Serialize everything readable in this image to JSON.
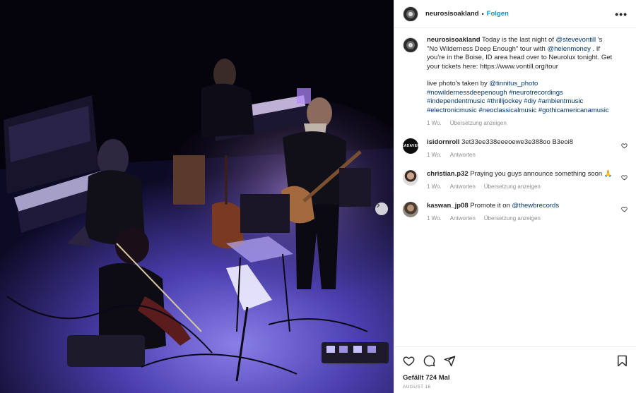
{
  "post": {
    "username": "neurosisoakland",
    "follow_label": "Folgen",
    "more_label": "•••",
    "separator": "•"
  },
  "caption": {
    "username": "neurosisoakland",
    "text_1": "Today is the last night of ",
    "mention_1": "@stevevontill",
    "text_2": " 's \"No Wilderness Deep Enough\" tour with ",
    "mention_2": "@helenmoney",
    "text_3": " . If you're in the Boise, ID area head over to Neurolux tonight. Get your tickets here: https://www.vontill.org/tour",
    "text_4": "live photo's taken by ",
    "mention_3": "@tinnitus_photo",
    "hashtags": "#nowildernessdeepenough #neurotrecordings #independentmusic #thrilljockey #diy #ambientmusic #electronicmusic #neoclassicalmusic #gothicamericanamusic",
    "time": "1 Wo.",
    "translation": "Übersetzung anzeigen"
  },
  "comments": [
    {
      "username": "isidornroll",
      "text": "3et33ee338eeeoewe3e388oo B3eoi8",
      "time": "1 Wo.",
      "reply": "Antworten",
      "avatar_text": "CADAVER"
    },
    {
      "username": "christian.p32",
      "text": "Praying you guys announce something soon 🙏",
      "time": "1 Wo.",
      "reply": "Antworten",
      "translation": "Übersetzung anzeigen"
    },
    {
      "username": "kaswan_jp08",
      "text_1": "Promote it on ",
      "mention": "@thewbrecords",
      "time": "1 Wo.",
      "reply": "Antworten",
      "translation": "Übersetzung anzeigen"
    }
  ],
  "footer": {
    "likes": "Gefällt 724 Mal",
    "date": "AUGUST 16"
  },
  "icons": {
    "like": "heart-icon",
    "comment": "comment-icon",
    "share": "send-icon",
    "save": "bookmark-icon",
    "next": "chevron-right-icon"
  },
  "colors": {
    "link": "#00376b",
    "follow": "#0095f6",
    "muted": "#8e8e8e",
    "stage_light": "#6a5cff"
  }
}
